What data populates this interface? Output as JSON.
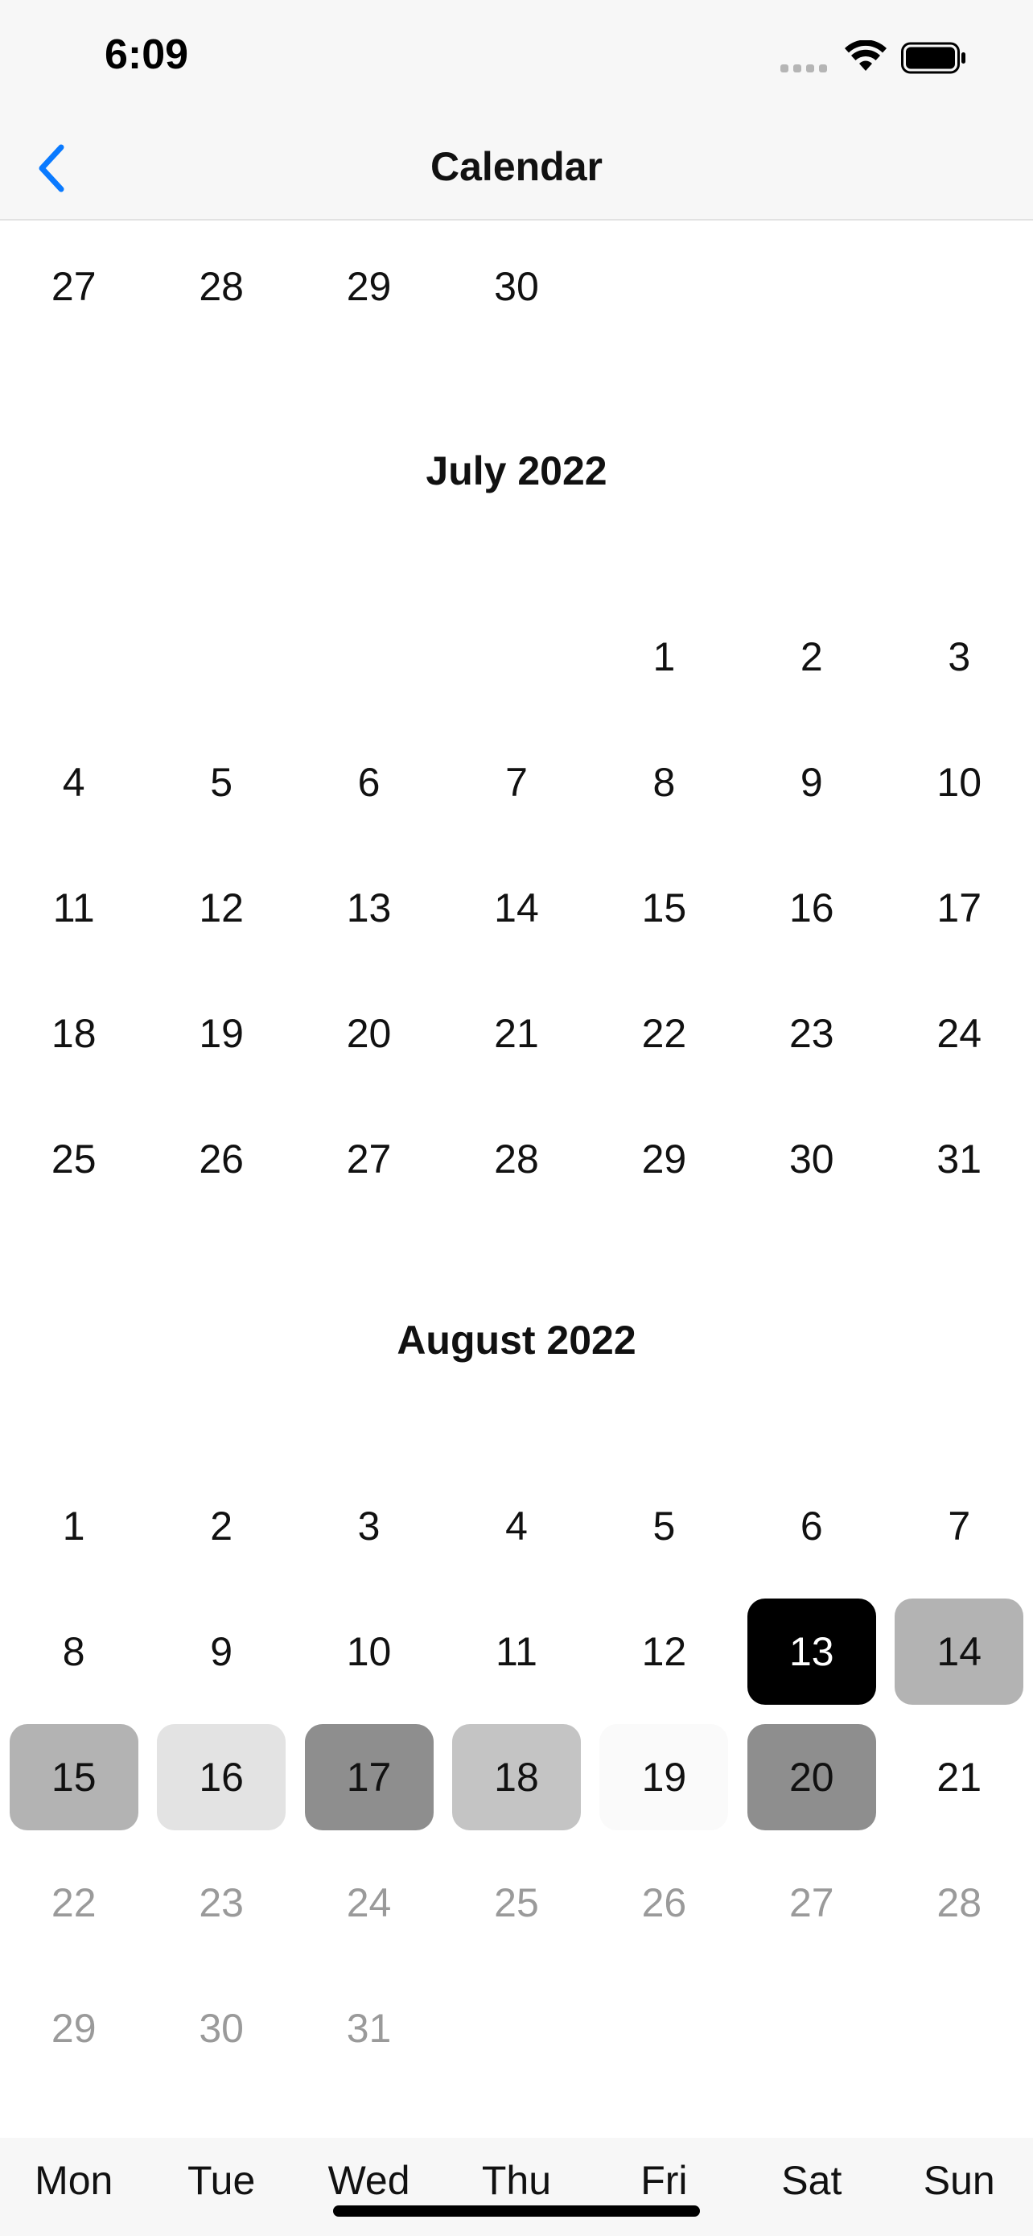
{
  "status_bar": {
    "time": "6:09"
  },
  "nav": {
    "title": "Calendar",
    "back_icon": "chevron-left-icon"
  },
  "colors": {
    "accent": "#0a7aff",
    "selected": "#000000",
    "level1": "#b3b3b3",
    "level2": "#c4c4c4",
    "level3": "#e3e3e3",
    "level4": "#8e8e8e",
    "level5": "#fafafa"
  },
  "june_tail": {
    "days": [
      "27",
      "28",
      "29",
      "30"
    ]
  },
  "july": {
    "title": "July 2022",
    "rows": [
      [
        "",
        "",
        "",
        "",
        "1",
        "2",
        "3"
      ],
      [
        "4",
        "5",
        "6",
        "7",
        "8",
        "9",
        "10"
      ],
      [
        "11",
        "12",
        "13",
        "14",
        "15",
        "16",
        "17"
      ],
      [
        "18",
        "19",
        "20",
        "21",
        "22",
        "23",
        "24"
      ],
      [
        "25",
        "26",
        "27",
        "28",
        "29",
        "30",
        "31"
      ]
    ]
  },
  "august": {
    "title": "August 2022",
    "rows": [
      [
        "1",
        "2",
        "3",
        "4",
        "5",
        "6",
        "7"
      ],
      [
        "8",
        "9",
        "10",
        "11",
        "12",
        "13",
        "14"
      ],
      [
        "15",
        "16",
        "17",
        "18",
        "19",
        "20",
        "21"
      ],
      [
        "22",
        "23",
        "24",
        "25",
        "26",
        "27",
        "28"
      ],
      [
        "29",
        "30",
        "31",
        "",
        "",
        "",
        ""
      ]
    ],
    "highlights": {
      "13": "selected",
      "14": "level1",
      "15": "level1",
      "16": "level3",
      "17": "level4",
      "18": "level2",
      "19": "level5",
      "20": "level4"
    },
    "faded_from": "22"
  },
  "weekdays": [
    "Mon",
    "Tue",
    "Wed",
    "Thu",
    "Fri",
    "Sat",
    "Sun"
  ]
}
